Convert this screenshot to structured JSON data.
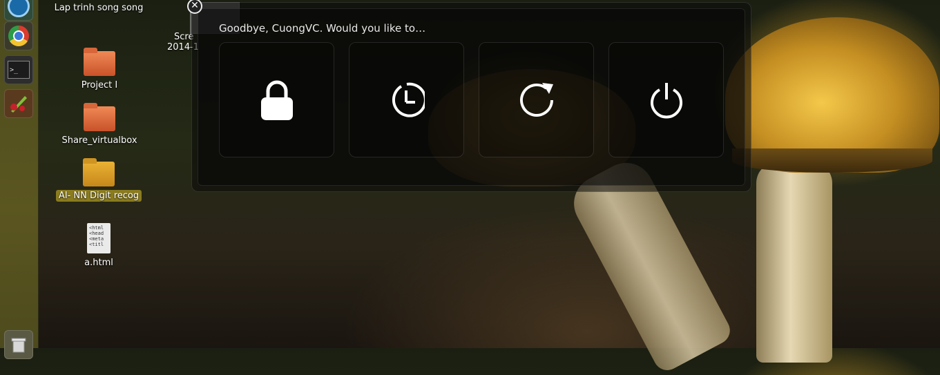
{
  "dialog": {
    "title": "Goodbye, CuongVC. Would you like to…",
    "close_symbol": "✕",
    "actions": [
      {
        "icon": "lock-icon"
      },
      {
        "icon": "suspend-icon"
      },
      {
        "icon": "restart-icon"
      },
      {
        "icon": "power-icon"
      }
    ]
  },
  "desktop": {
    "icons": [
      {
        "label": "Lap trinh song song"
      },
      {
        "label": "Project I"
      },
      {
        "label": "Share_virtualbox"
      },
      {
        "label": "AI- NN Digit recog"
      },
      {
        "label": "a.html",
        "preview": "<html\n<head\n<meta\n<titl"
      },
      {
        "label_line1": "Scre",
        "label_line2": "2014-1"
      }
    ]
  },
  "launcher": {
    "items": [
      "files-icon",
      "chrome-icon",
      "terminal-icon",
      "paint-icon",
      "trash-icon"
    ],
    "terminal_glyph": ">_"
  },
  "colors": {
    "selected_label_bg": "#8b7c1e",
    "dialog_bg": "rgba(10,10,10,0.55)",
    "launcher_bg": "#4a4a1e"
  }
}
